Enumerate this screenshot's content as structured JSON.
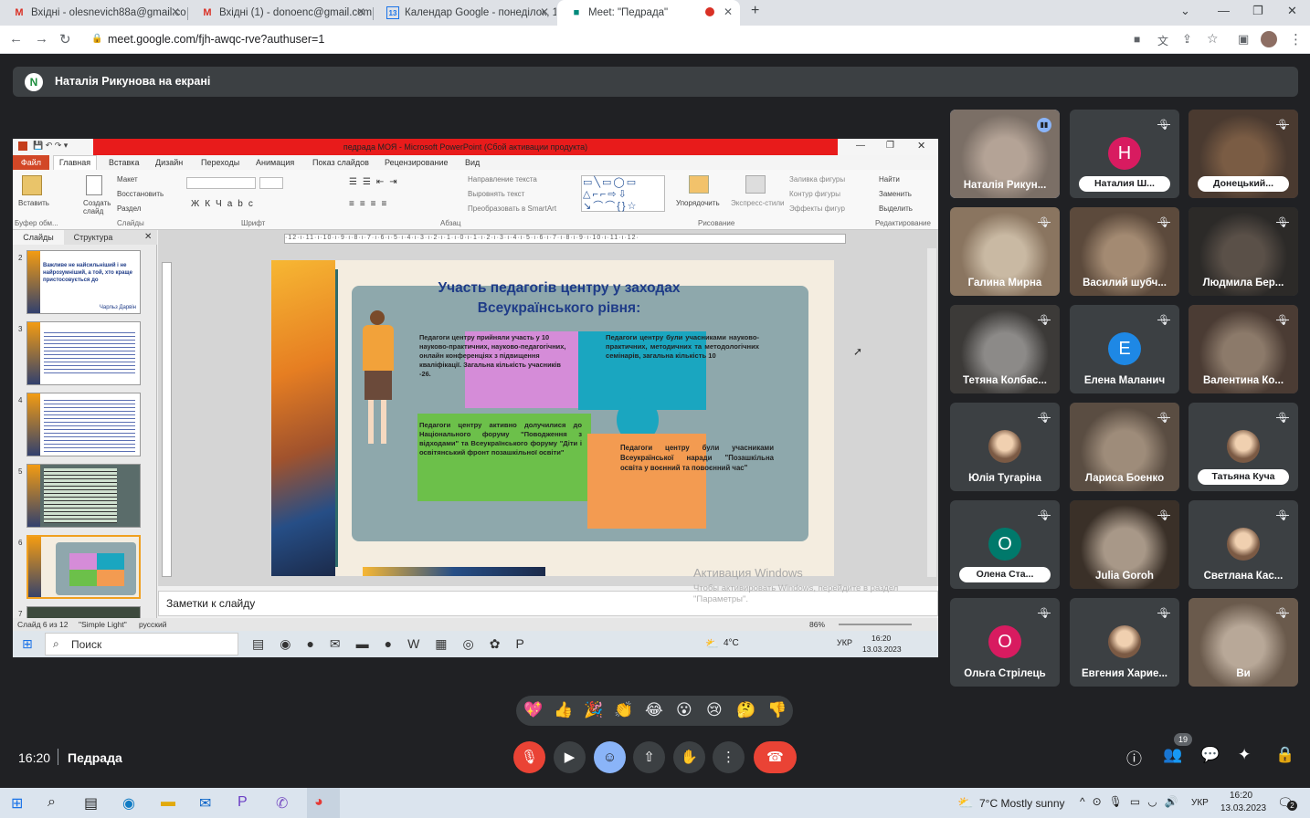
{
  "browser": {
    "tabs": [
      {
        "title": "Вхідні - olesnevich88a@gmail.co",
        "icon": "gmail-icon"
      },
      {
        "title": "Вхідні (1) - donoenc@gmail.com",
        "icon": "gmail-icon"
      },
      {
        "title": "Календар Google - понеділок, 1",
        "icon": "calendar-icon"
      },
      {
        "title": "Meet: \"Педрада\"",
        "icon": "meet-icon"
      }
    ],
    "url": "meet.google.com/fjh-awqc-rve?authuser=1"
  },
  "meet": {
    "presenter_banner": "Наталія Рикунова на екрані",
    "presenter_initial": "N",
    "time": "16:20",
    "meeting_name": "Педрада",
    "participants_count": "19",
    "participants": [
      {
        "name": "Наталія Рикун...",
        "type": "video",
        "speaking": true
      },
      {
        "name": "Наталия Ш...",
        "type": "letter",
        "letter": "Н",
        "color": "#d81b60",
        "pill": true
      },
      {
        "name": "Донецький...",
        "type": "video",
        "pill": true
      },
      {
        "name": "Галина Мирна",
        "type": "video"
      },
      {
        "name": "Василий шубч...",
        "type": "video"
      },
      {
        "name": "Людмила Бер...",
        "type": "video"
      },
      {
        "name": "Тетяна Колбас...",
        "type": "video"
      },
      {
        "name": "Елена Маланич",
        "type": "letter",
        "letter": "E",
        "color": "#1e88e5"
      },
      {
        "name": "Валентина Ко...",
        "type": "video"
      },
      {
        "name": "Юлія Тугаріна",
        "type": "avatar"
      },
      {
        "name": "Лариса Боенко",
        "type": "video"
      },
      {
        "name": "Татьяна Куча",
        "type": "avatar",
        "pill": true
      },
      {
        "name": "Олена Ста...",
        "type": "letter",
        "letter": "О",
        "color": "#00796b",
        "pill": true
      },
      {
        "name": "Julia Goroh",
        "type": "video"
      },
      {
        "name": "Светлана Кас...",
        "type": "avatar"
      },
      {
        "name": "Ольга Стрілець",
        "type": "letter",
        "letter": "О",
        "color": "#d81b60"
      },
      {
        "name": "Евгения Харие...",
        "type": "avatar"
      },
      {
        "name": "Ви",
        "type": "video"
      }
    ],
    "reactions": [
      "💖",
      "👍",
      "🎉",
      "👏",
      "😂",
      "😮",
      "😢",
      "🤔",
      "👎"
    ]
  },
  "ppt": {
    "title": "педрада МОЯ - Microsoft PowerPoint (Сбой активации продукта)",
    "tabs": [
      "Файл",
      "Главная",
      "Вставка",
      "Дизайн",
      "Переходы",
      "Анимация",
      "Показ слайдов",
      "Рецензирование",
      "Вид"
    ],
    "groups": [
      "Буфер обм...",
      "Слайды",
      "Шрифт",
      "Абзац",
      "Рисование",
      "Редактирование"
    ],
    "ribbon_labels": {
      "paste": "Вставить",
      "create_slide": "Создать слайд",
      "layout": "Макет",
      "restore": "Восстановить",
      "section": "Раздел",
      "text_direction": "Направление текста",
      "align_text": "Выровнять текст",
      "smartart": "Преобразовать в SmartArt",
      "arrange": "Упорядочить",
      "express": "Экспресс-стили",
      "fill": "Заливка фигуры",
      "outline": "Контур фигуры",
      "effects": "Эффекты фигур",
      "find": "Найти",
      "replace": "Заменить",
      "select": "Выделить"
    },
    "panel_tabs": [
      "Слайды",
      "Структура"
    ],
    "slide_numbers": [
      "2",
      "3",
      "4",
      "5",
      "6",
      "7"
    ],
    "thumb2_text": "Важливе не найсильніший і не найрозумніший, а той, хто краще пристосовується до",
    "thumb2_author": "Чарльз Дарвін",
    "slide": {
      "title": "Участь педагогів центру у заходах Всеукраїнського рівня:",
      "block1": "Педагоги центру прийняли участь у 10 науково-практичних, науково-педагогічних, онлайн конференціях з підвищення кваліфікації. Загальна кількість учасників -26.",
      "block2": "Педагоги центру були учасниками науково-практичних, методичних та методологічних семінарів, загальна кількість 10",
      "block3": "Педагоги центру активно долучилися до Національного форуму \"Поводження з відходами\" та Всеукраїнського форуму \"Діти і освітянський фронт позашкільної освіти\"",
      "block4": "Педагоги центру були учасниками Всеукраїнської наради \"Позашкільна освіта у воєнний та повоєнний час\""
    },
    "notes_placeholder": "Заметки к слайду",
    "status": {
      "slide": "Слайд 6 из 12",
      "theme": "\"Simple Light\"",
      "lang": "русский",
      "zoom": "86%"
    },
    "watermark_title": "Активация Windows",
    "watermark_sub": "Чтобы активировать Windows, перейдите в раздел \"Параметры\".",
    "inner_taskbar": {
      "search": "Поиск",
      "temp": "4°C",
      "lang": "УКР",
      "time": "16:20",
      "date": "13.03.2023"
    }
  },
  "windows": {
    "weather": "7°C  Mostly sunny",
    "lang": "УКР",
    "time": "16:20",
    "date": "13.03.2023",
    "notif": "2"
  }
}
